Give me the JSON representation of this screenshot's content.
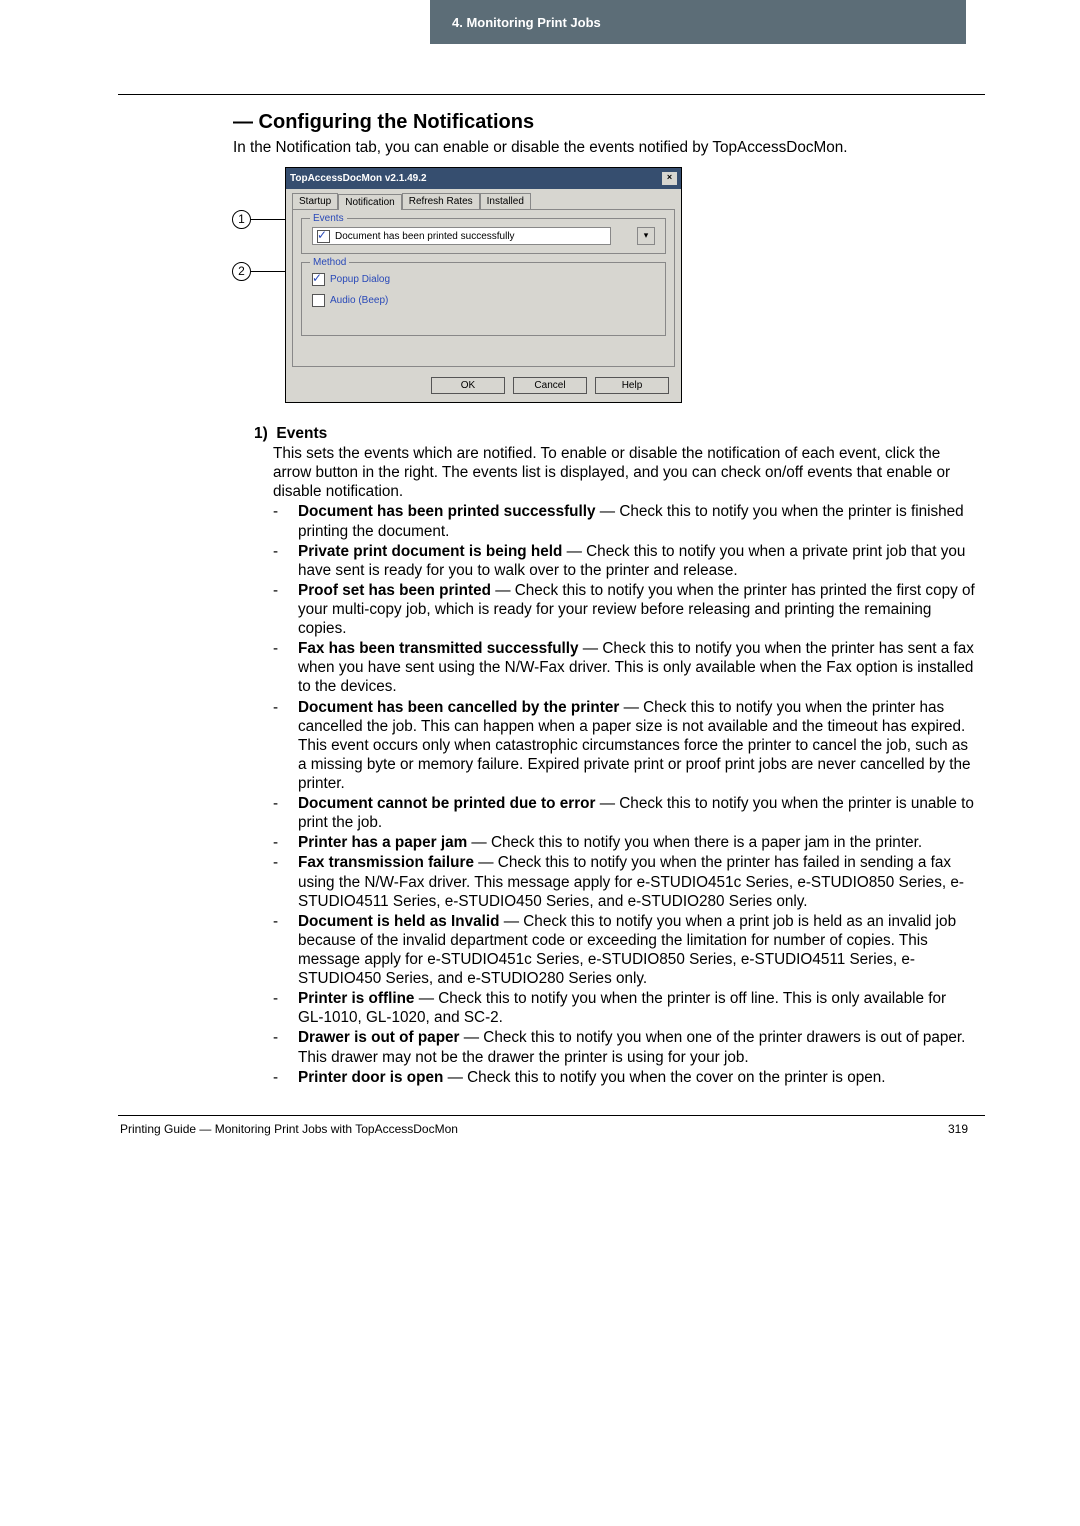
{
  "header": {
    "chapter": "4. Monitoring Print Jobs"
  },
  "title": "— Configuring the Notifications",
  "intro": "In the Notification tab, you can enable or disable the events notified by TopAccessDocMon.",
  "dialog": {
    "title": "TopAccessDocMon v2.1.49.2",
    "tabs": [
      "Startup",
      "Notification",
      "Refresh Rates",
      "Installed"
    ],
    "events_group": "Events",
    "event_line": "Document has been printed successfully",
    "method_group": "Method",
    "method_popup": "Popup Dialog",
    "method_audio": "Audio (Beep)",
    "btn_ok": "OK",
    "btn_cancel": "Cancel",
    "btn_help": "Help"
  },
  "callouts": {
    "c1": "1",
    "c2": "2"
  },
  "section": {
    "events_num": "1)",
    "events_label": "Events",
    "events_desc": "This sets the events which are notified.  To enable or disable the notification of each event, click the arrow button in the right.  The events list is displayed, and you can check on/off events that enable or disable notification.",
    "items": [
      {
        "b": "Document has been printed successfully",
        "rest": " — Check this to notify you when the printer is finished printing the document."
      },
      {
        "b": "Private print document is being held",
        "rest": " — Check this to notify you when a private print job that you have sent is ready for you to walk over to the printer and release."
      },
      {
        "b": "Proof set has been printed",
        "rest": " — Check this to notify you when the printer has printed the first copy of your multi-copy job, which is ready for your review before releasing and printing the remaining copies."
      },
      {
        "b": "Fax has been transmitted successfully",
        "rest": " — Check this to notify you when the printer has sent a fax when you have sent using the N/W-Fax driver.  This is only available when the Fax option is installed to the devices."
      },
      {
        "b": "Document has been cancelled by the printer",
        "rest": " — Check this to notify you when the printer has cancelled the job.  This can happen when a paper size is not available and the timeout has expired.  This event occurs only when catastrophic circumstances force the printer to cancel the job, such as a missing byte or memory failure.  Expired private print or proof print jobs are never cancelled by the printer."
      },
      {
        "b": "Document cannot be printed due to error",
        "rest": " — Check this to notify you when the printer is unable to print the job."
      },
      {
        "b": "Printer has a paper jam",
        "rest": " — Check this to notify you when there is a paper jam in the printer."
      },
      {
        "b": "Fax transmission failure",
        "rest": " — Check this to notify you when the printer has failed in sending a fax using the N/W-Fax driver.  This message apply for e-STUDIO451c Series, e-STUDIO850 Series, e-STUDIO4511 Series, e-STUDIO450 Series, and e-STUDIO280 Series only."
      },
      {
        "b": "Document is held as Invalid",
        "rest": " — Check this to notify you when a print job is held as an invalid job because of the invalid department code or exceeding the limitation for number of copies.  This message apply for e-STUDIO451c Series, e-STUDIO850 Series, e-STUDIO4511 Series, e-STUDIO450 Series, and e-STUDIO280 Series only."
      },
      {
        "b": "Printer is offline",
        "rest": " — Check this to notify you when the printer is off line.  This is only available for GL-1010, GL-1020, and SC-2."
      },
      {
        "b": "Drawer is out of paper",
        "rest": " — Check this to notify you when one of the printer drawers is out of paper. This drawer may not be the drawer the printer is using for your job."
      },
      {
        "b": "Printer door is open",
        "rest": " — Check this to notify you when the cover on the printer is open."
      }
    ]
  },
  "footer": {
    "left": "Printing Guide — Monitoring Print Jobs with TopAccessDocMon",
    "right": "319"
  }
}
